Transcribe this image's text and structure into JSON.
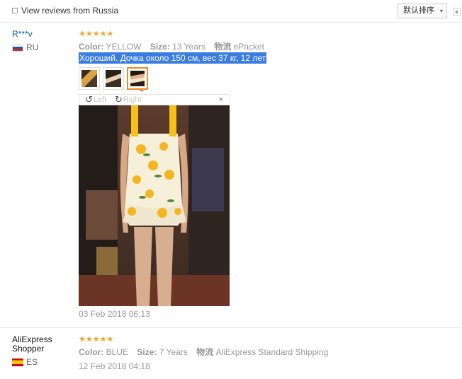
{
  "toolbar": {
    "filter_label": "View reviews from Russia",
    "sort_label": "默认排序",
    "sort_caret": "▾"
  },
  "reviews": [
    {
      "user": "R***v",
      "country": "RU",
      "stars": "★★★★★",
      "color_label": "Color:",
      "color_value": "YELLOW",
      "size_label": "Size:",
      "size_value": "13 Years",
      "shipping_label": "物流",
      "shipping_value": "ePacket",
      "comment": "Хороший. Дочка около 150 см, вес 37 кг, 12 лет",
      "viewer": {
        "left_label": "Left",
        "right_label": "Right",
        "close_label": "×"
      },
      "date": "03 Feb 2018 06:13"
    },
    {
      "user": "AliExpress Shopper",
      "country": "ES",
      "stars": "★★★★★",
      "color_label": "Color:",
      "color_value": "BLUE",
      "size_label": "Size:",
      "size_value": "7 Years",
      "shipping_label": "物流",
      "shipping_value": "AliExpress Standard Shipping",
      "date": "12 Feb 2018 04:18"
    }
  ],
  "colors": {
    "accent_orange": "#f08a24",
    "star": "#f7a21b",
    "link": "#0b5aa8",
    "selection": "#3a7ce0"
  }
}
